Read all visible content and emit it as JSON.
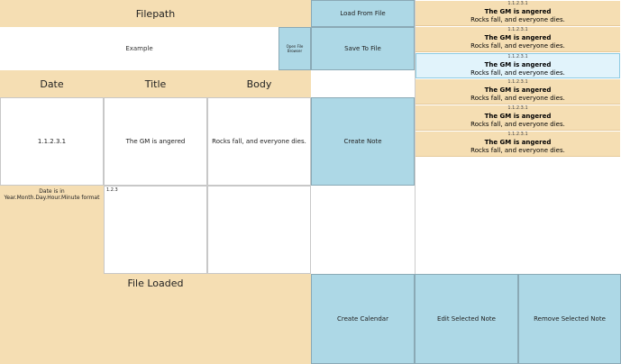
{
  "filepath": {
    "label": "Filepath",
    "value": "Example",
    "open_browser_label": "Open File Browser"
  },
  "buttons": {
    "load": "Load From File",
    "save": "Save To File",
    "create_note": "Create Note",
    "create_calendar": "Create Calendar",
    "edit_note": "Edit Selected Note",
    "remove_note": "Remove Selected Note"
  },
  "table": {
    "headers": [
      "Date",
      "Title",
      "Body"
    ],
    "row": {
      "date": "1.1.2.3.1",
      "title": "The GM is angered",
      "body": "Rocks fall, and everyone dies."
    },
    "date_hint": "Date is in Year.Month.Day.Hour.Minute format",
    "small_value": "1.2.3"
  },
  "status": "File Loaded",
  "notes": [
    {
      "date": "1.1.2.3.1",
      "title": "The GM is angered",
      "body": "Rocks fall, and everyone dies."
    },
    {
      "date": "1.1.2.3.1",
      "title": "The GM is angered",
      "body": "Rocks fall, and everyone dies."
    },
    {
      "date": "1.1.2.3.1",
      "title": "The GM is angered",
      "body": "Rocks fall, and everyone dies."
    },
    {
      "date": "1.1.2.3.1",
      "title": "The GM is angered",
      "body": "Rocks fall, and everyone dies."
    },
    {
      "date": "1.1.2.3.1",
      "title": "The GM is angered",
      "body": "Rocks fall, and everyone dies."
    },
    {
      "date": "1.1.2.3.1",
      "title": "The GM is angered",
      "body": "Rocks fall, and everyone dies."
    }
  ],
  "colors": {
    "panel": "#f5deb3",
    "button": "#add8e6",
    "selected": "#e1f3fb"
  }
}
